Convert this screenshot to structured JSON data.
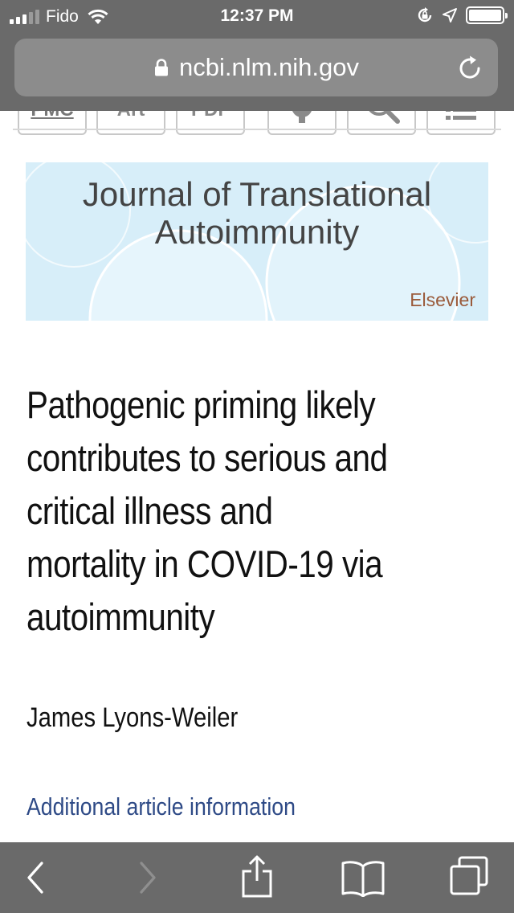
{
  "status_bar": {
    "carrier": "Fido",
    "time": "12:37 PM",
    "battery_level": 1.0
  },
  "browser": {
    "url": "ncbi.nlm.nih.gov"
  },
  "page_tools": {
    "pmc_label": "PMC",
    "art_label": "Art",
    "pdf_label": "PDF"
  },
  "journal_banner": {
    "title_line1": "Journal of Translational",
    "title_line2": "Autoimmunity",
    "publisher": "Elsevier"
  },
  "article": {
    "title_lines": [
      "Pathogenic priming likely",
      "contributes to serious and",
      "critical illness and",
      "mortality in COVID-19 via",
      "autoimmunity"
    ],
    "author": "James Lyons-Weiler",
    "additional_info_link": "Additional article information"
  },
  "colors": {
    "chrome": "#6a6a6a",
    "banner_bg": "#d7eef9",
    "link": "#2e4a86",
    "publisher": "#9a5a3a"
  }
}
